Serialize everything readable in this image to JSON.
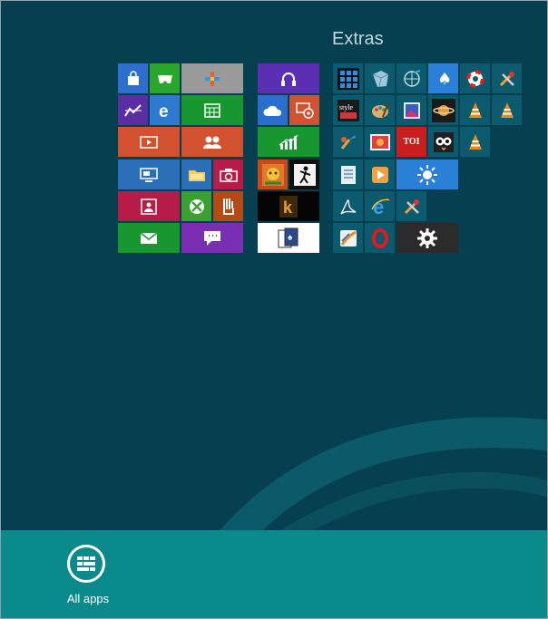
{
  "start_screen": {
    "group_extras_title": "Extras"
  },
  "tiles": [
    {
      "id": "store",
      "color": "#2e6fce",
      "icon": "store-icon"
    },
    {
      "id": "games",
      "color": "#2aa62c",
      "icon": "game-controller-icon"
    },
    {
      "id": "maps",
      "color": "#9a9a9a",
      "icon": "plus-colorful-icon"
    },
    {
      "id": "finance",
      "color": "#5b2da2",
      "icon": "finance-icon"
    },
    {
      "id": "ie",
      "color": "#2d7ad0",
      "icon": "internet-explorer-icon"
    },
    {
      "id": "calendar",
      "color": "#18962f",
      "icon": "calendar-icon"
    },
    {
      "id": "video",
      "color": "#d2512e",
      "icon": "video-icon"
    },
    {
      "id": "people",
      "color": "#d2512e",
      "icon": "people-icon"
    },
    {
      "id": "desktop",
      "color": "#2a6fb8",
      "icon": "desktop-icon"
    },
    {
      "id": "explorer",
      "color": "#2a6fb8",
      "icon": "folder-icon"
    },
    {
      "id": "camera",
      "color": "#b71c48",
      "icon": "camera-icon"
    },
    {
      "id": "photos",
      "color": "#b71c48",
      "icon": "photos-icon"
    },
    {
      "id": "xbox",
      "color": "#3aa032",
      "icon": "xbox-icon"
    },
    {
      "id": "reader",
      "color": "#b54a14",
      "icon": "reader-icon"
    },
    {
      "id": "mail",
      "color": "#18962f",
      "icon": "mail-icon"
    },
    {
      "id": "messaging",
      "color": "#7a2fb2",
      "icon": "messaging-icon"
    },
    {
      "id": "music",
      "color": "#5a2fb2",
      "icon": "headphones-icon"
    },
    {
      "id": "skydrive",
      "color": "#2a6fce",
      "icon": "cloud-icon"
    },
    {
      "id": "remote-desktop",
      "color": "#d2512e",
      "icon": "remote-desktop-icon"
    },
    {
      "id": "stocks",
      "color": "#18962f",
      "icon": "chart-icon"
    },
    {
      "id": "game-a",
      "color": "#c84a1a",
      "icon": "game-a-icon"
    },
    {
      "id": "game-b",
      "color": "#101010",
      "icon": "figure-icon"
    },
    {
      "id": "kindle",
      "color": "#050505",
      "icon": "kindle-icon"
    },
    {
      "id": "solitaire",
      "color": "#ffffff",
      "icon": "cards-icon"
    },
    {
      "id": "x-calc",
      "color": "#0c5a6e",
      "icon": "grid-icon"
    },
    {
      "id": "x-fresh",
      "color": "#0c5a6e",
      "icon": "cube-icon"
    },
    {
      "id": "x-net",
      "color": "#0c5a6e",
      "icon": "globe-icon"
    },
    {
      "id": "x-cards",
      "color": "#2a7fd6",
      "icon": "spade-icon"
    },
    {
      "id": "x-shield",
      "color": "#0c5a6e",
      "icon": "lifebuoy-icon"
    },
    {
      "id": "x-tools",
      "color": "#0c5a6e",
      "icon": "tools-icon"
    },
    {
      "id": "x-style",
      "color": "#0c5a6e",
      "icon": "style-icon"
    },
    {
      "id": "x-paint",
      "color": "#0c5a6e",
      "icon": "palette-icon"
    },
    {
      "id": "x-photo",
      "color": "#0c5a6e",
      "icon": "photo-frame-icon"
    },
    {
      "id": "x-saturn",
      "color": "#0c5a6e",
      "icon": "saturn-icon"
    },
    {
      "id": "x-vlc1",
      "color": "#0c5a6e",
      "icon": "cone-icon"
    },
    {
      "id": "x-vlc2",
      "color": "#0c5a6e",
      "icon": "cone-icon"
    },
    {
      "id": "x-brush",
      "color": "#0c5a6e",
      "icon": "brush-icon"
    },
    {
      "id": "x-pics",
      "color": "#0c5a6e",
      "icon": "pictures-icon"
    },
    {
      "id": "x-toi",
      "color": "#c81e1e",
      "icon": "toi-icon",
      "label": "TOI"
    },
    {
      "id": "x-owl",
      "color": "#0c5a6e",
      "icon": "owl-icon"
    },
    {
      "id": "x-vlc3",
      "color": "#0c5a6e",
      "icon": "cone-icon"
    },
    {
      "id": "x-doc",
      "color": "#0c5a6e",
      "icon": "document-icon"
    },
    {
      "id": "x-play",
      "color": "#0c5a6e",
      "icon": "play-icon"
    },
    {
      "id": "x-weather",
      "color": "#2a7fd6",
      "icon": "sun-icon"
    },
    {
      "id": "x-acrobat",
      "color": "#0c5a6e",
      "icon": "acrobat-icon"
    },
    {
      "id": "x-ie2",
      "color": "#0c5a6e",
      "icon": "internet-explorer-icon"
    },
    {
      "id": "x-tools2",
      "color": "#0c5a6e",
      "icon": "tools-icon"
    },
    {
      "id": "x-firefox",
      "color": "#0c5a6e",
      "icon": "firefox-icon"
    },
    {
      "id": "x-opera",
      "color": "#0c5a6e",
      "icon": "opera-icon"
    },
    {
      "id": "x-settings",
      "color": "#2b2b2b",
      "icon": "gear-icon"
    }
  ],
  "appbar": {
    "all_apps_label": "All apps",
    "all_apps_icon": "all-apps-icon"
  },
  "colors": {
    "background": "#063f4f",
    "appbar": "#0b8a8c"
  }
}
